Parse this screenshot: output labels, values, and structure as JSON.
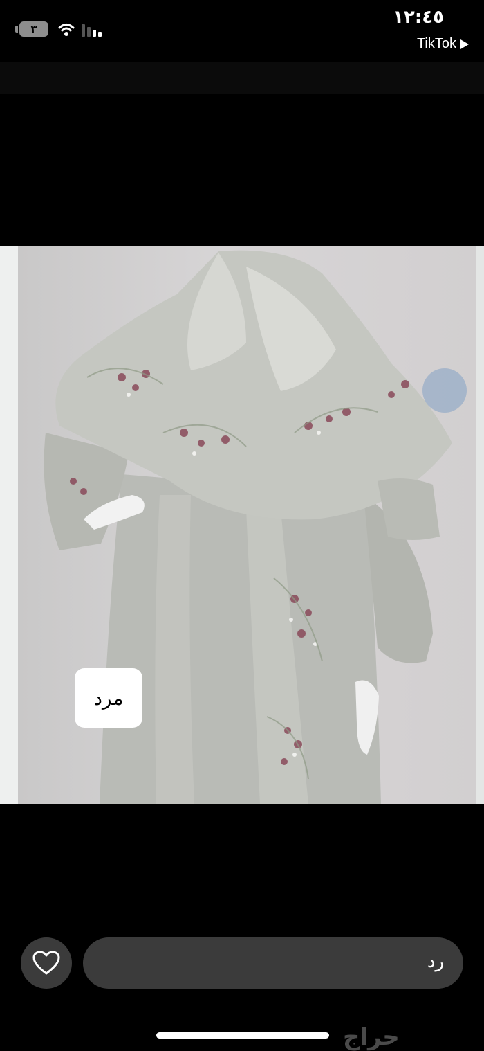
{
  "status_bar": {
    "battery": "٣",
    "time": "١٢:٤٥",
    "back_app": "TikTok"
  },
  "photo": {
    "tag": "مرد"
  },
  "reply": {
    "placeholder": "رد"
  },
  "icons": [
    "heart-icon",
    "wifi-icon",
    "signal-icon",
    "battery-icon",
    "play-triangle-icon"
  ],
  "watermark": "حراج"
}
